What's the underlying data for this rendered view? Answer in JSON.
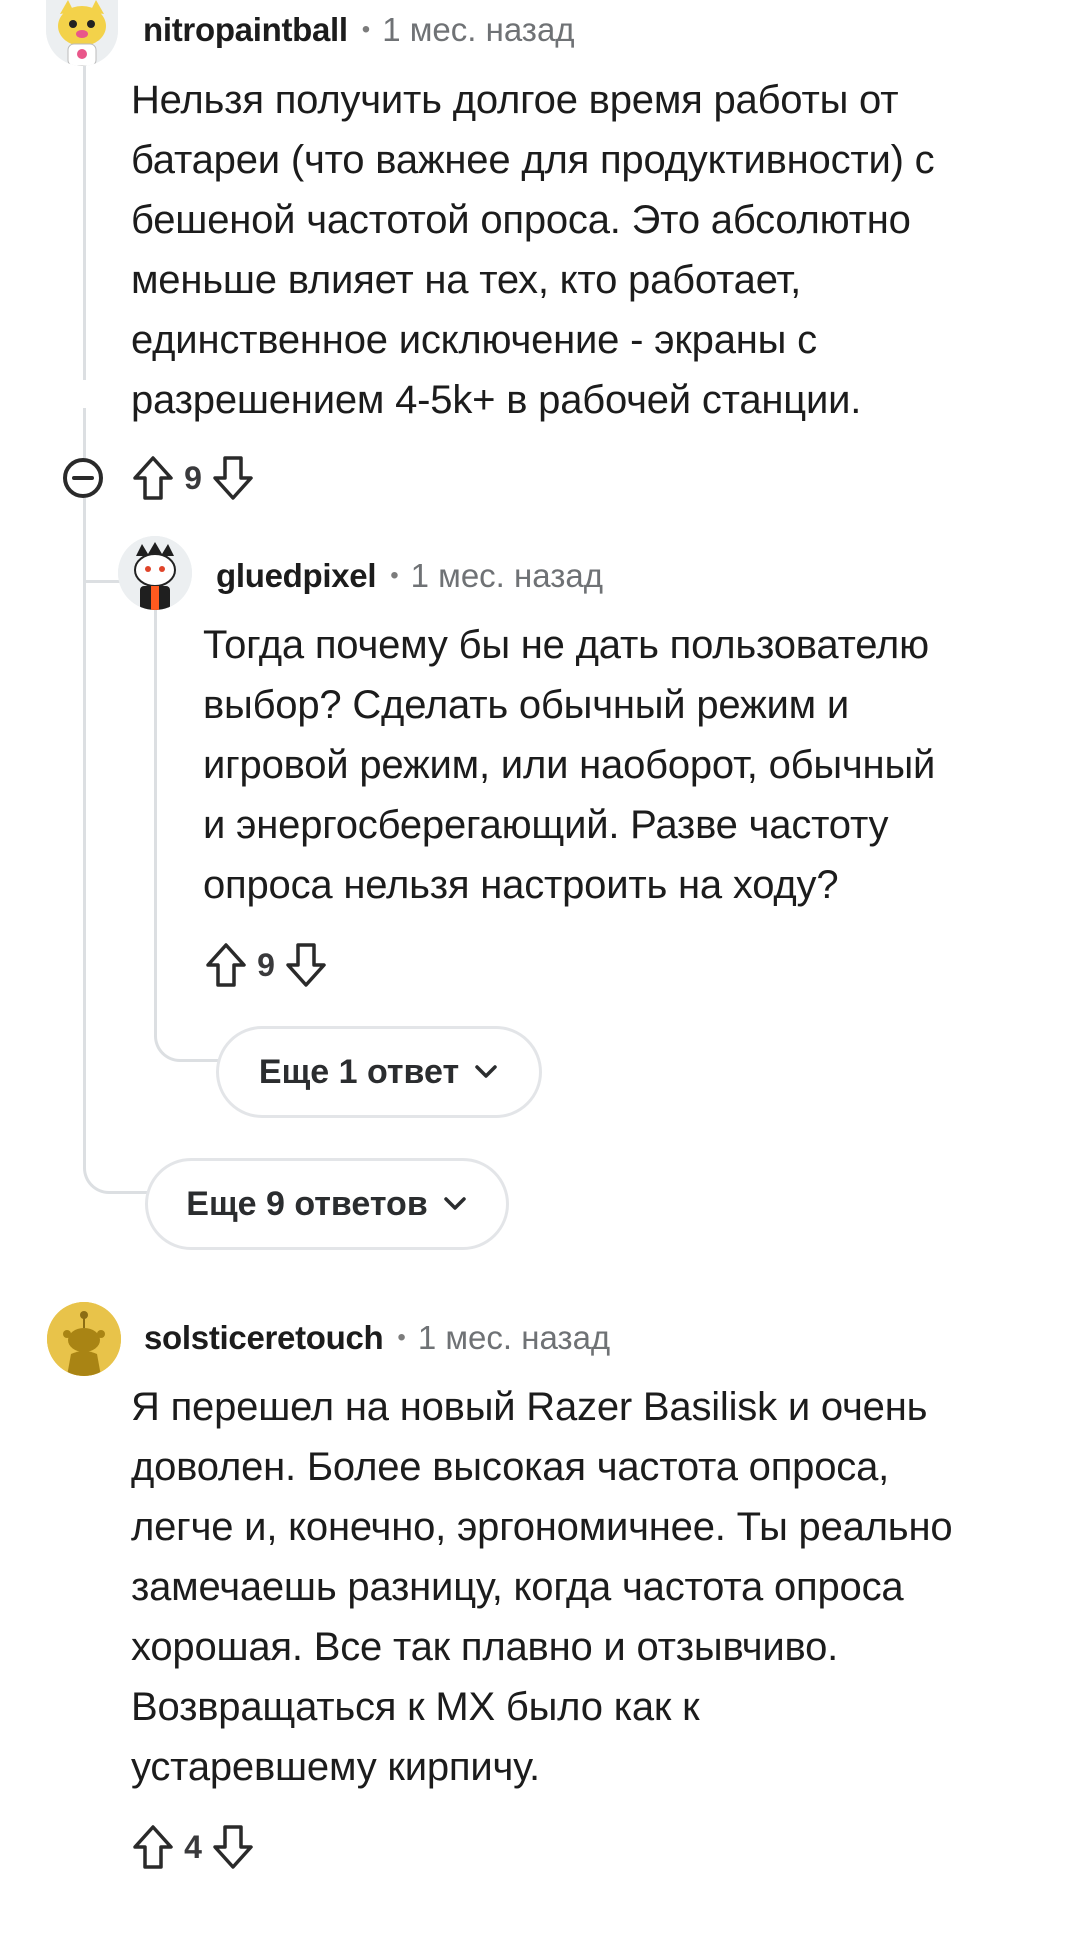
{
  "comments": [
    {
      "username": "nitropaintball",
      "separator": "•",
      "time": "1 мес. назад",
      "body_lines": [
        "Нельзя получить долгое время работы от",
        "батареи (что важнее для продуктивности) с",
        "бешеной частотой опроса. Это абсолютно",
        "меньше влияет на тех, кто работает,",
        "единственное исключение - экраны с",
        "разрешением 4-5k+ в рабочей станции."
      ],
      "votes": "9",
      "avatar_icon": "cat-avatar-icon"
    },
    {
      "username": "gluedpixel",
      "separator": "•",
      "time": "1 мес. назад",
      "body_lines": [
        "Тогда почему бы не дать пользователю",
        "выбор? Сделать обычный режим и",
        "игровой режим, или наоборот, обычный",
        "и энергосберегающий. Разве частоту",
        "опроса нельзя настроить на ходу?"
      ],
      "votes": "9",
      "avatar_icon": "snoo-avatar-icon"
    },
    {
      "username": "solsticeretouch",
      "separator": "•",
      "time": "1 мес. назад",
      "body_lines": [
        "Я перешел на новый Razer Basilisk и очень",
        "доволен. Более высокая частота опроса,",
        "легче и, конечно, эргономичнее. Ты реально",
        "замечаешь разницу, когда частота опроса",
        "хорошая. Все так плавно и отзывчиво.",
        "Возвращаться к MX было как к",
        "устаревшему кирпичу."
      ],
      "votes": "4",
      "avatar_icon": "default-snoo-avatar-icon"
    }
  ],
  "more_replies_nested": "Еще 1 ответ",
  "more_replies_top": "Еще 9 ответов",
  "colors": {
    "thread_line": "#dcdfe2",
    "text": "#1c1c1c",
    "meta": "#6f7275",
    "default_avatar_bg": "#e8c34a"
  }
}
